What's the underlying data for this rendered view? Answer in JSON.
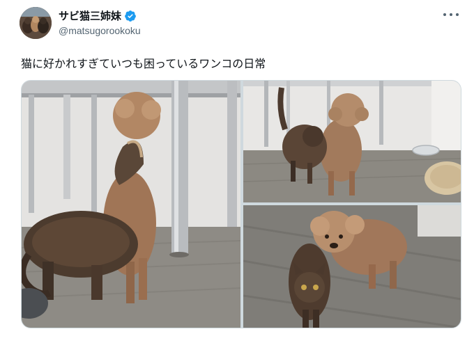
{
  "user": {
    "display_name": "サビ猫三姉妹",
    "handle": "@matsugorookoku",
    "verified": true,
    "verified_icon": "verified-badge-icon",
    "verified_color": "#1d9bf0"
  },
  "tweet": {
    "text": "猫に好かれすぎていつも困っているワンコの日常"
  },
  "menu": {
    "icon": "more-options-icon"
  },
  "media": {
    "photo_count": 3
  },
  "colors": {
    "text_primary": "#0f1419",
    "text_secondary": "#536471",
    "border": "#cfd9de"
  }
}
